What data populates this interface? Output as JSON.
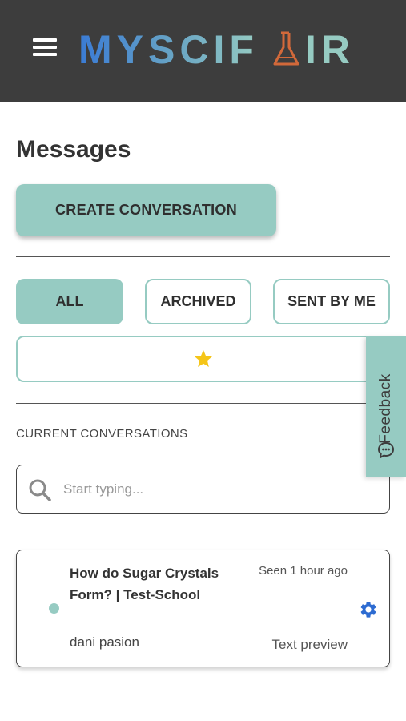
{
  "header": {
    "logo_text": "MYSCIFAIR",
    "menu_icon": "hamburger-menu-icon",
    "background": "#3d3d3d"
  },
  "page": {
    "title": "Messages"
  },
  "actions": {
    "create_label": "CREATE CONVERSATION"
  },
  "filters": [
    {
      "label": "ALL",
      "active": true
    },
    {
      "label": "ARCHIVED",
      "active": false
    },
    {
      "label": "SENT BY ME",
      "active": false
    }
  ],
  "starred_filter": {
    "icon": "star-icon",
    "color": "#f5c518"
  },
  "feedback": {
    "label": "Feedback",
    "icon": "feedback-icon"
  },
  "conversations": {
    "section_label": "CURRENT CONVERSATIONS",
    "search": {
      "placeholder": "Start typing...",
      "value": ""
    },
    "items": [
      {
        "title": "How do Sugar Crystals Form? | Test-School",
        "author": "dani pasion",
        "seen": "Seen 1 hour ago",
        "preview": "Text preview",
        "unread": true
      }
    ]
  },
  "colors": {
    "accent": "#96cbc2",
    "gear": "#2d6bd1",
    "logo_gradient_start": "#3a7bd5",
    "logo_gradient_end": "#96cbc2",
    "flask": "#d2693a"
  }
}
